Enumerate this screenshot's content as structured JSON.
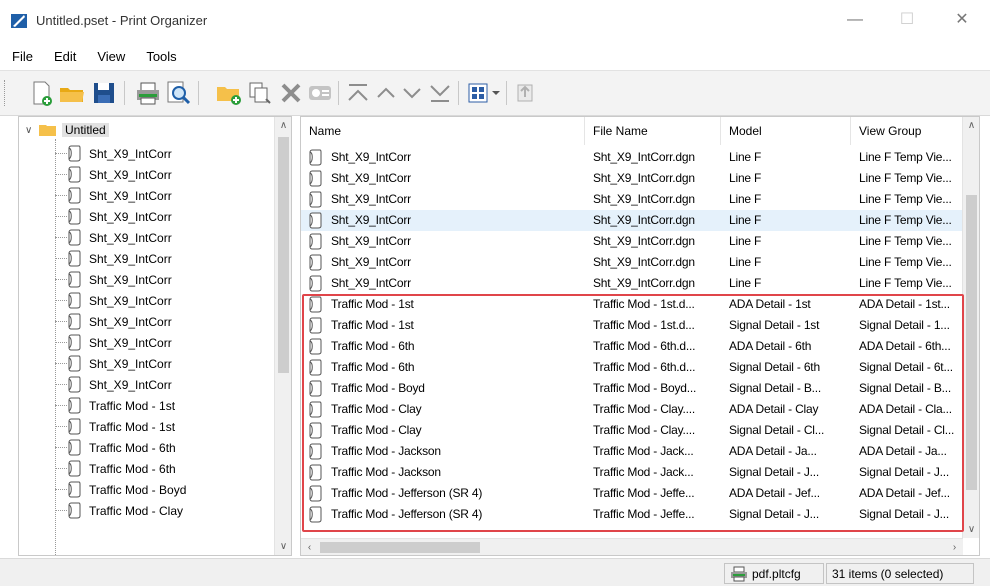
{
  "window": {
    "title": "Untitled.pset - Print Organizer"
  },
  "menu": [
    "File",
    "Edit",
    "View",
    "Tools"
  ],
  "toolbar": {
    "icons": [
      "new-set-icon",
      "open-icon",
      "save-icon",
      "print-icon",
      "preview-icon",
      "add-folder-icon",
      "add-files-icon",
      "delete-icon",
      "properties-icon",
      "move-top-icon",
      "move-up-icon",
      "move-down-icon",
      "move-bottom-icon",
      "display-options-icon",
      "export-icon"
    ]
  },
  "tree": {
    "root": "Untitled",
    "items": [
      "Sht_X9_IntCorr",
      "Sht_X9_IntCorr",
      "Sht_X9_IntCorr",
      "Sht_X9_IntCorr",
      "Sht_X9_IntCorr",
      "Sht_X9_IntCorr",
      "Sht_X9_IntCorr",
      "Sht_X9_IntCorr",
      "Sht_X9_IntCorr",
      "Sht_X9_IntCorr",
      "Sht_X9_IntCorr",
      "Sht_X9_IntCorr",
      "Traffic Mod - 1st",
      "Traffic Mod - 1st",
      "Traffic Mod - 6th",
      "Traffic Mod - 6th",
      "Traffic Mod - Boyd",
      "Traffic Mod - Clay"
    ]
  },
  "list": {
    "columns": [
      "Name",
      "File Name",
      "Model",
      "View Group"
    ],
    "rows": [
      [
        "Sht_X9_IntCorr",
        "Sht_X9_IntCorr.dgn",
        "Line F",
        "Line F Temp Vie..."
      ],
      [
        "Sht_X9_IntCorr",
        "Sht_X9_IntCorr.dgn",
        "Line F",
        "Line F Temp Vie..."
      ],
      [
        "Sht_X9_IntCorr",
        "Sht_X9_IntCorr.dgn",
        "Line F",
        "Line F Temp Vie..."
      ],
      [
        "Sht_X9_IntCorr",
        "Sht_X9_IntCorr.dgn",
        "Line F",
        "Line F Temp Vie..."
      ],
      [
        "Sht_X9_IntCorr",
        "Sht_X9_IntCorr.dgn",
        "Line F",
        "Line F Temp Vie..."
      ],
      [
        "Sht_X9_IntCorr",
        "Sht_X9_IntCorr.dgn",
        "Line F",
        "Line F Temp Vie..."
      ],
      [
        "Sht_X9_IntCorr",
        "Sht_X9_IntCorr.dgn",
        "Line F",
        "Line F Temp Vie..."
      ],
      [
        "Traffic Mod - 1st",
        "Traffic Mod - 1st.d...",
        "ADA Detail - 1st",
        "ADA Detail - 1st..."
      ],
      [
        "Traffic Mod - 1st",
        "Traffic Mod - 1st.d...",
        "Signal Detail - 1st",
        "Signal Detail - 1..."
      ],
      [
        "Traffic Mod - 6th",
        "Traffic Mod - 6th.d...",
        "ADA Detail - 6th",
        "ADA Detail - 6th..."
      ],
      [
        "Traffic Mod - 6th",
        "Traffic Mod - 6th.d...",
        "Signal Detail - 6th",
        "Signal Detail - 6t..."
      ],
      [
        "Traffic Mod - Boyd",
        "Traffic Mod - Boyd...",
        "Signal Detail - B...",
        "Signal Detail - B..."
      ],
      [
        "Traffic Mod - Clay",
        "Traffic Mod - Clay....",
        "ADA Detail - Clay",
        "ADA Detail - Cla..."
      ],
      [
        "Traffic Mod - Clay",
        "Traffic Mod - Clay....",
        "Signal Detail - Cl...",
        "Signal Detail - Cl..."
      ],
      [
        "Traffic Mod - Jackson",
        "Traffic Mod - Jack...",
        "ADA Detail - Ja...",
        "ADA Detail - Ja..."
      ],
      [
        "Traffic Mod - Jackson",
        "Traffic Mod - Jack...",
        "Signal Detail - J...",
        "Signal Detail - J..."
      ],
      [
        "Traffic Mod - Jefferson (SR 4)",
        "Traffic Mod - Jeffe...",
        "ADA Detail - Jef...",
        "ADA Detail - Jef..."
      ],
      [
        "Traffic Mod - Jefferson (SR 4)",
        "Traffic Mod - Jeffe...",
        "Signal Detail - J...",
        "Signal Detail - J..."
      ]
    ],
    "selected_row": 3
  },
  "status": {
    "printer": "pdf.pltcfg",
    "count": "31 items (0 selected)"
  },
  "colors": {
    "highlight": "#e0454a",
    "selection": "#e5f1fb",
    "folder": "#f5c04a"
  }
}
